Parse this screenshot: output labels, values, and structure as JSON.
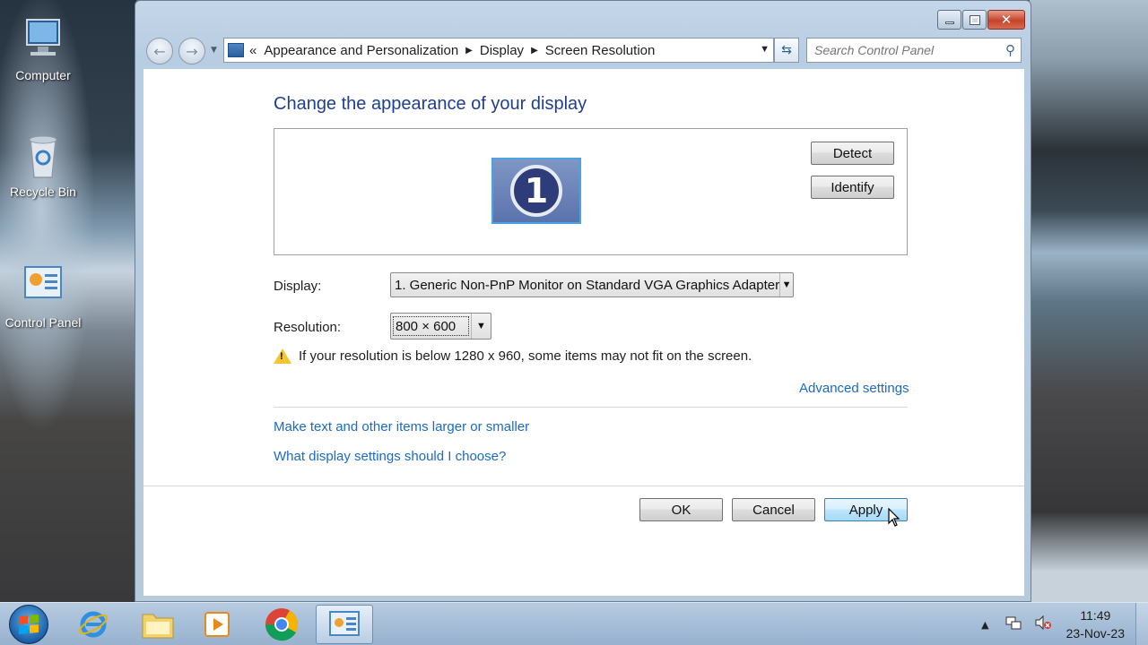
{
  "desktop": {
    "icons": [
      {
        "label": "Computer"
      },
      {
        "label": "Recycle Bin"
      },
      {
        "label": "Control Panel"
      }
    ]
  },
  "window": {
    "breadcrumb": [
      "Appearance and Personalization",
      "Display",
      "Screen Resolution"
    ],
    "search_placeholder": "Search Control Panel"
  },
  "page": {
    "title": "Change the appearance of your display",
    "monitor_number": "1",
    "detect_label": "Detect",
    "identify_label": "Identify",
    "display_label": "Display:",
    "display_value": "1. Generic Non-PnP Monitor on Standard VGA Graphics Adapter",
    "resolution_label": "Resolution:",
    "resolution_value": "800 × 600",
    "warning": "If your resolution is below 1280 x 960, some items may not fit on the screen.",
    "advanced_link": "Advanced settings",
    "link_text_size": "Make text and other items larger or smaller",
    "link_help": "What display settings should I choose?",
    "ok_label": "OK",
    "cancel_label": "Cancel",
    "apply_label": "Apply"
  },
  "taskbar": {
    "time": "11:49",
    "date": "23-Nov-23"
  },
  "colors": {
    "link": "#1a6bc4",
    "title": "#1e3f8f",
    "warning": "#f2c531"
  }
}
